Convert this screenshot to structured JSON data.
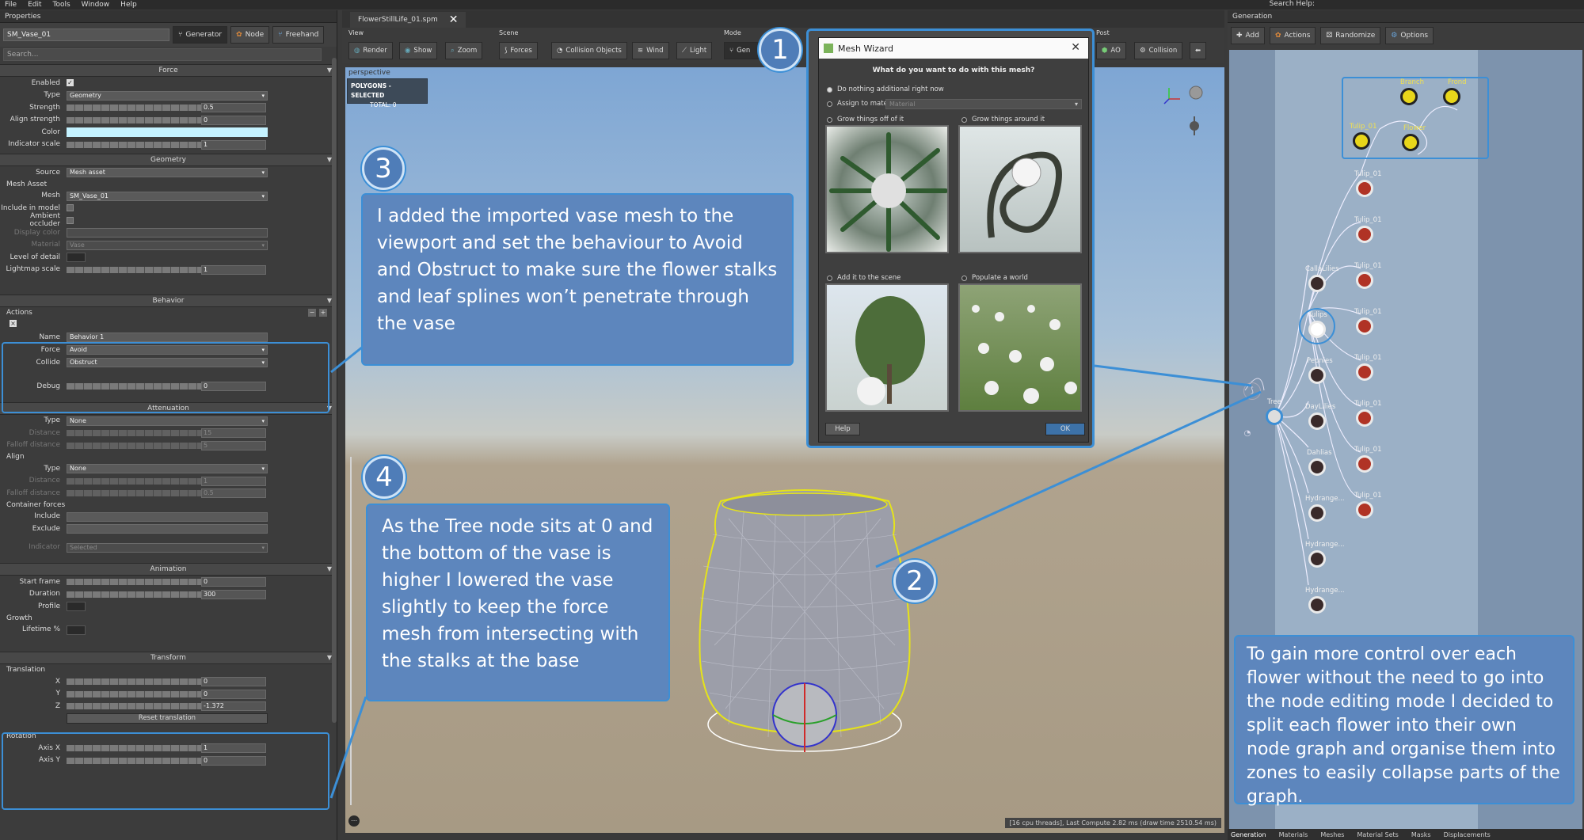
{
  "menu": [
    "File",
    "Edit",
    "Tools",
    "Window",
    "Help"
  ],
  "search_help": "Search Help:",
  "properties": {
    "title": "Properties",
    "name_value": "SM_Vase_01",
    "modes": [
      "Generator",
      "Node",
      "Freehand"
    ],
    "search_placeholder": "Search...",
    "force": {
      "header": "Force",
      "enabled_label": "Enabled",
      "type_label": "Type",
      "type_value": "Geometry",
      "strength_label": "Strength",
      "strength_value": "0.5",
      "align_label": "Align strength",
      "align_value": "0",
      "color_label": "Color",
      "indicator_label": "Indicator scale",
      "indicator_value": "1"
    },
    "geometry": {
      "header": "Geometry",
      "source_label": "Source",
      "source_value": "Mesh asset",
      "mesh_asset_group": "Mesh Asset",
      "mesh_label": "Mesh",
      "mesh_value": "SM_Vase_01",
      "include_label": "Include in model",
      "ambient_label": "Ambient occluder",
      "display_color_label": "Display color",
      "material_label": "Material",
      "material_value": "Vase",
      "lod_label": "Level of detail",
      "lightmap_label": "Lightmap scale",
      "lightmap_value": "1"
    },
    "behavior": {
      "header": "Behavior",
      "actions_group": "Actions",
      "name_label": "Name",
      "name_value": "Behavior 1",
      "force_label": "Force",
      "force_value": "Avoid",
      "collide_label": "Collide",
      "collide_value": "Obstruct",
      "debug_label": "Debug",
      "debug_value": "0"
    },
    "attenuation": {
      "header": "Attenuation",
      "type_label": "Type",
      "type_value": "None",
      "distance_label": "Distance",
      "distance_value": "15",
      "falloff_label": "Falloff distance",
      "falloff_value": "5",
      "align_group": "Align",
      "align_type_label": "Type",
      "align_type_value": "None",
      "align_distance_label": "Distance",
      "align_distance_value": "1",
      "align_falloff_label": "Falloff distance",
      "align_falloff_value": "0.5",
      "container_group": "Container forces",
      "include_label": "Include",
      "exclude_label": "Exclude",
      "indicator_label": "Indicator",
      "indicator_value": "Selected"
    },
    "animation": {
      "header": "Animation",
      "start_label": "Start frame",
      "start_value": "0",
      "duration_label": "Duration",
      "duration_value": "300",
      "profile_label": "Profile",
      "growth_group": "Growth",
      "lifetime_label": "Lifetime %"
    },
    "transform": {
      "header": "Transform",
      "translation_group": "Translation",
      "x_label": "X",
      "x_value": "0",
      "y_label": "Y",
      "y_value": "0",
      "z_label": "Z",
      "z_value": "-1.372",
      "reset_label": "Reset translation",
      "rotation_group": "Rotation",
      "axisx_label": "Axis X",
      "axisx_value": "1",
      "axisy_label": "Axis Y",
      "axisy_value": "0"
    }
  },
  "file_tab": "FlowerStillLife_01.spm",
  "toolbar": {
    "view_group": "View",
    "scene_group": "Scene",
    "mode_group": "Mode",
    "post_group": "Post",
    "render": "Render",
    "show": "Show",
    "zoom": "Zoom",
    "forces": "Forces",
    "collision_objects": "Collision Objects",
    "wind": "Wind",
    "light": "Light",
    "gen": "Gen",
    "ao": "AO",
    "collision": "Collision"
  },
  "viewport": {
    "perspective": "perspective",
    "polys_title": "POLYGONS - SELECTED",
    "polys_total": "TOTAL:  0",
    "status": "[16 cpu threads], Last Compute 2.82 ms (draw time 2510.54 ms)"
  },
  "wizard": {
    "title": "Mesh Wizard",
    "question": "What do you want to do with this mesh?",
    "opt_nothing": "Do nothing additional right now",
    "opt_assign": "Assign to material",
    "material_placeholder": "Material",
    "opt_grow_off": "Grow things off of it",
    "opt_grow_around": "Grow things around it",
    "opt_add_scene": "Add it to the scene",
    "opt_populate": "Populate a world",
    "help": "Help",
    "ok": "OK"
  },
  "callouts": {
    "c1": "1",
    "c2": "2",
    "c3": "3",
    "c4": "4",
    "text3": "I added the imported vase mesh to the viewport and set the behaviour to Avoid and Obstruct to make sure the flower stalks and leaf splines won’t penetrate through the vase",
    "text4": "As the Tree node sits at 0 and the bottom of the vase is higher I lowered the vase slightly to keep the force mesh from intersecting with the stalks at the base",
    "text_right": "To gain more control over each flower without the need to go into the node editing mode I decided to split each flower into their own node graph and organise them into zones to easily collapse parts of the graph."
  },
  "generation": {
    "title": "Generation",
    "add": "Add",
    "actions": "Actions",
    "randomize": "Randomize",
    "options": "Options",
    "nodes": {
      "branch": "Branch",
      "frond": "Frond",
      "tulip_top": "Tulip_01",
      "flower": "Flower",
      "tulip": "Tulip_01",
      "calla": "CallaLilies",
      "tulips": "Tulips",
      "peonies": "Peonies",
      "daylilies": "DayLilies",
      "dahlias": "Dahlias",
      "hydrangea": "Hydrange...",
      "tree": "Tree"
    },
    "bottom_tabs": [
      "Generation",
      "Materials",
      "Meshes",
      "Material Sets",
      "Masks",
      "Displacements"
    ]
  },
  "colors": {
    "accent": "#3c8fd6",
    "callout_bg": "#5d86bd",
    "node_red": "#b03325",
    "node_yellow": "#e8d61a"
  }
}
